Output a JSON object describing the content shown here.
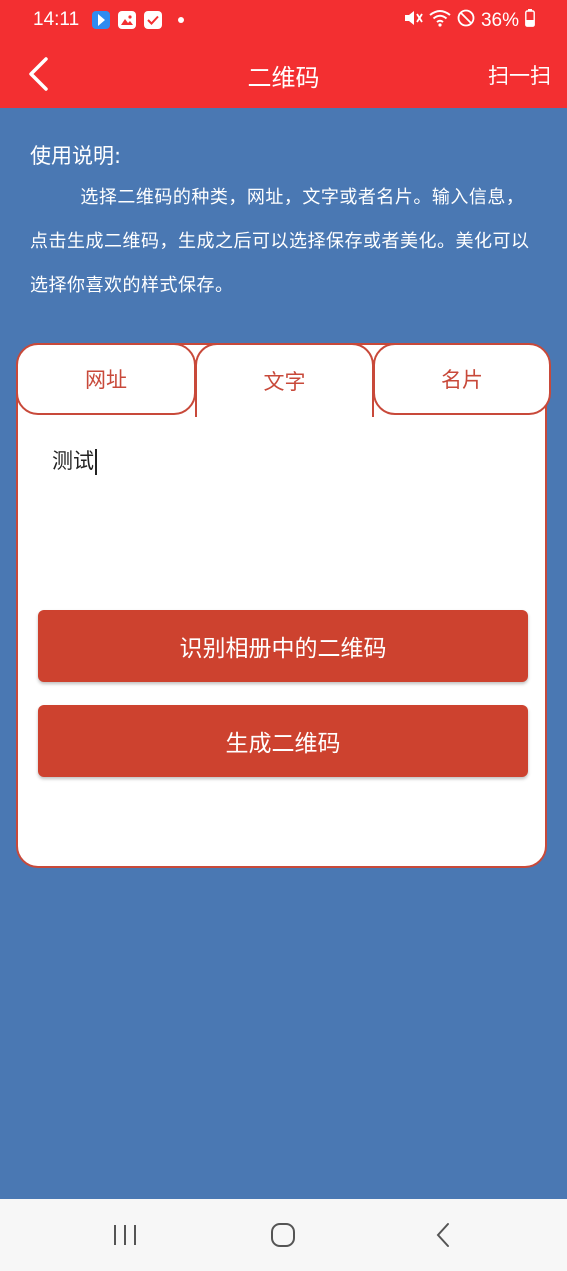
{
  "status_bar": {
    "time": "14:11",
    "battery": "36%",
    "icons": [
      "app-notification-icon",
      "gallery-icon",
      "checkbox-icon",
      "dot-icon",
      "mute-icon",
      "wifi-icon",
      "dnd-icon",
      "battery-icon"
    ]
  },
  "app_bar": {
    "title": "二维码",
    "scan_label": "扫一扫"
  },
  "instructions": {
    "heading": "使用说明:",
    "body": "选择二维码的种类，网址，文字或者名片。输入信息，点击生成二维码，生成之后可以选择保存或者美化。美化可以选择你喜欢的样式保存。"
  },
  "tabs": [
    {
      "label": "网址"
    },
    {
      "label": "文字"
    },
    {
      "label": "名片"
    }
  ],
  "active_tab": 1,
  "input": {
    "value": "测试"
  },
  "buttons": {
    "recognize": "识别相册中的二维码",
    "generate": "生成二维码"
  },
  "colors": {
    "app_bar": "#f32f31",
    "background": "#4a78b3",
    "accent": "#cd422f",
    "tab_border": "#c8493a"
  }
}
